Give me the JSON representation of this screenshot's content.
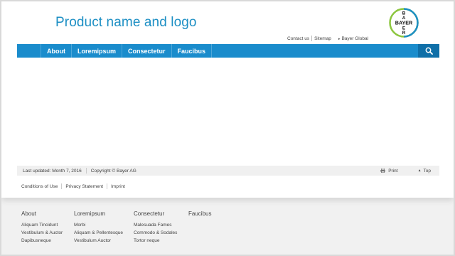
{
  "header": {
    "title": "Product name and logo",
    "logo_text": {
      "top": "B",
      "middle": "BAYER",
      "bottom_letters": [
        "Y",
        "E",
        "R"
      ],
      "left": "B",
      "center": "A"
    },
    "util_links": [
      "Contact us",
      "Sitemap"
    ],
    "global_link": "Bayer Global"
  },
  "nav": {
    "items": [
      "About",
      "Loremipsum",
      "Consectetur",
      "Faucibus"
    ],
    "search_icon": "search-icon"
  },
  "footer_bar": {
    "updated": "Last updated: Month 7, 2016",
    "copyright": "Copyright © Bayer AG",
    "print": "Print",
    "top": "Top"
  },
  "legal": [
    "Conditions of Use",
    "Privacy Statement",
    "Imprint"
  ],
  "sitemap": [
    {
      "heading": "About",
      "links": [
        "Aliquam Tincidunt",
        "Vestibulum & Auctor",
        "Dapibusneque"
      ]
    },
    {
      "heading": "Loremipsum",
      "links": [
        "Morbi",
        "Aliquam & Pellentesque",
        "Vestibulum Auctor"
      ]
    },
    {
      "heading": "Consectetur",
      "links": [
        "Malesuada Fames",
        "Commodo & Sodales",
        "Tortor neque"
      ]
    },
    {
      "heading": "Faucibus",
      "links": []
    }
  ],
  "colors": {
    "brand_blue": "#1d8fc4",
    "nav_blue": "#1a8ccc",
    "search_blue": "#0f6fa8",
    "logo_green": "#8cc63f"
  }
}
